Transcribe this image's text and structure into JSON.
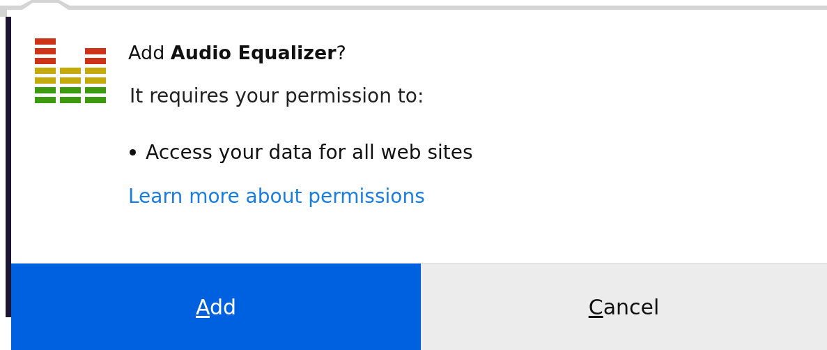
{
  "dialog": {
    "title": "Add **Audio Equalizer**?",
    "subtitle": "It requires your permission to:",
    "permissions": [
      "Access your data for all web sites"
    ],
    "link": "Learn more about permissions",
    "buttons": [
      {
        "access_key": "A",
        "label_rest": "dd",
        "kind": "primary"
      },
      {
        "access_key": "C",
        "label_rest": "ancel",
        "kind": "secondary"
      }
    ]
  }
}
